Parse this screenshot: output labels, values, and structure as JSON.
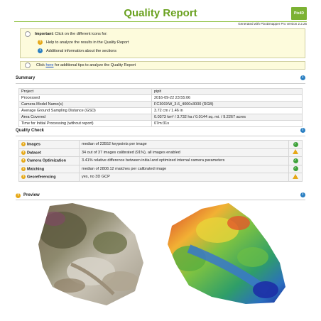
{
  "header": {
    "title": "Quality Report",
    "generated": "Generated with Pix4Dmapper Pro version 2.2.25",
    "logo_text": "Pix4D"
  },
  "note": {
    "important_label": "Important",
    "important_text": ": Click on the different icons for:",
    "help_text": "Help to analyze the results in the Quality Report",
    "info_text": "Additional information about the sections",
    "tips_prefix": "Click ",
    "tips_link": "here",
    "tips_suffix": " for additional tips to analyze the Quality Report"
  },
  "summary": {
    "title": "Summary",
    "rows": [
      {
        "key": "Project",
        "value": "pipit"
      },
      {
        "key": "Processed",
        "value": "2016-09-22 23:55:06"
      },
      {
        "key": "Camera Model Name(s)",
        "value": "FC300XW_3.6_4000x3000 (RGB)"
      },
      {
        "key": "Average Ground Sampling Distance (GSD)",
        "value": "3.72 cm / 1.46 in"
      },
      {
        "key": "Area Covered",
        "value": "0.0373 km² / 3.732 ha / 0.0144 sq. mi. / 9.2267 acres"
      },
      {
        "key": "Time for Initial Processing (without report)",
        "value": "07m:31s"
      }
    ]
  },
  "quality_check": {
    "title": "Quality Check",
    "rows": [
      {
        "key": "Images",
        "value": "median of 23552 keypoints per image",
        "status": "ok"
      },
      {
        "key": "Dataset",
        "value": "34 out of 37 images calibrated (91%), all images enabled",
        "status": "warn"
      },
      {
        "key": "Camera Optimization",
        "value": "3.41% relative difference between initial and optimized internal camera parameters",
        "status": "ok"
      },
      {
        "key": "Matching",
        "value": "median of 2808.12 matches per calibrated image",
        "status": "ok"
      },
      {
        "key": "Georeferencing",
        "value": "yes, no 3D GCP",
        "status": "warn"
      }
    ]
  },
  "preview": {
    "title": "Preview"
  },
  "colors": {
    "accent_green": "#6aa120",
    "info_blue": "#2a7fc2",
    "help_orange": "#e6a817",
    "ok_green": "#3ea23a"
  }
}
